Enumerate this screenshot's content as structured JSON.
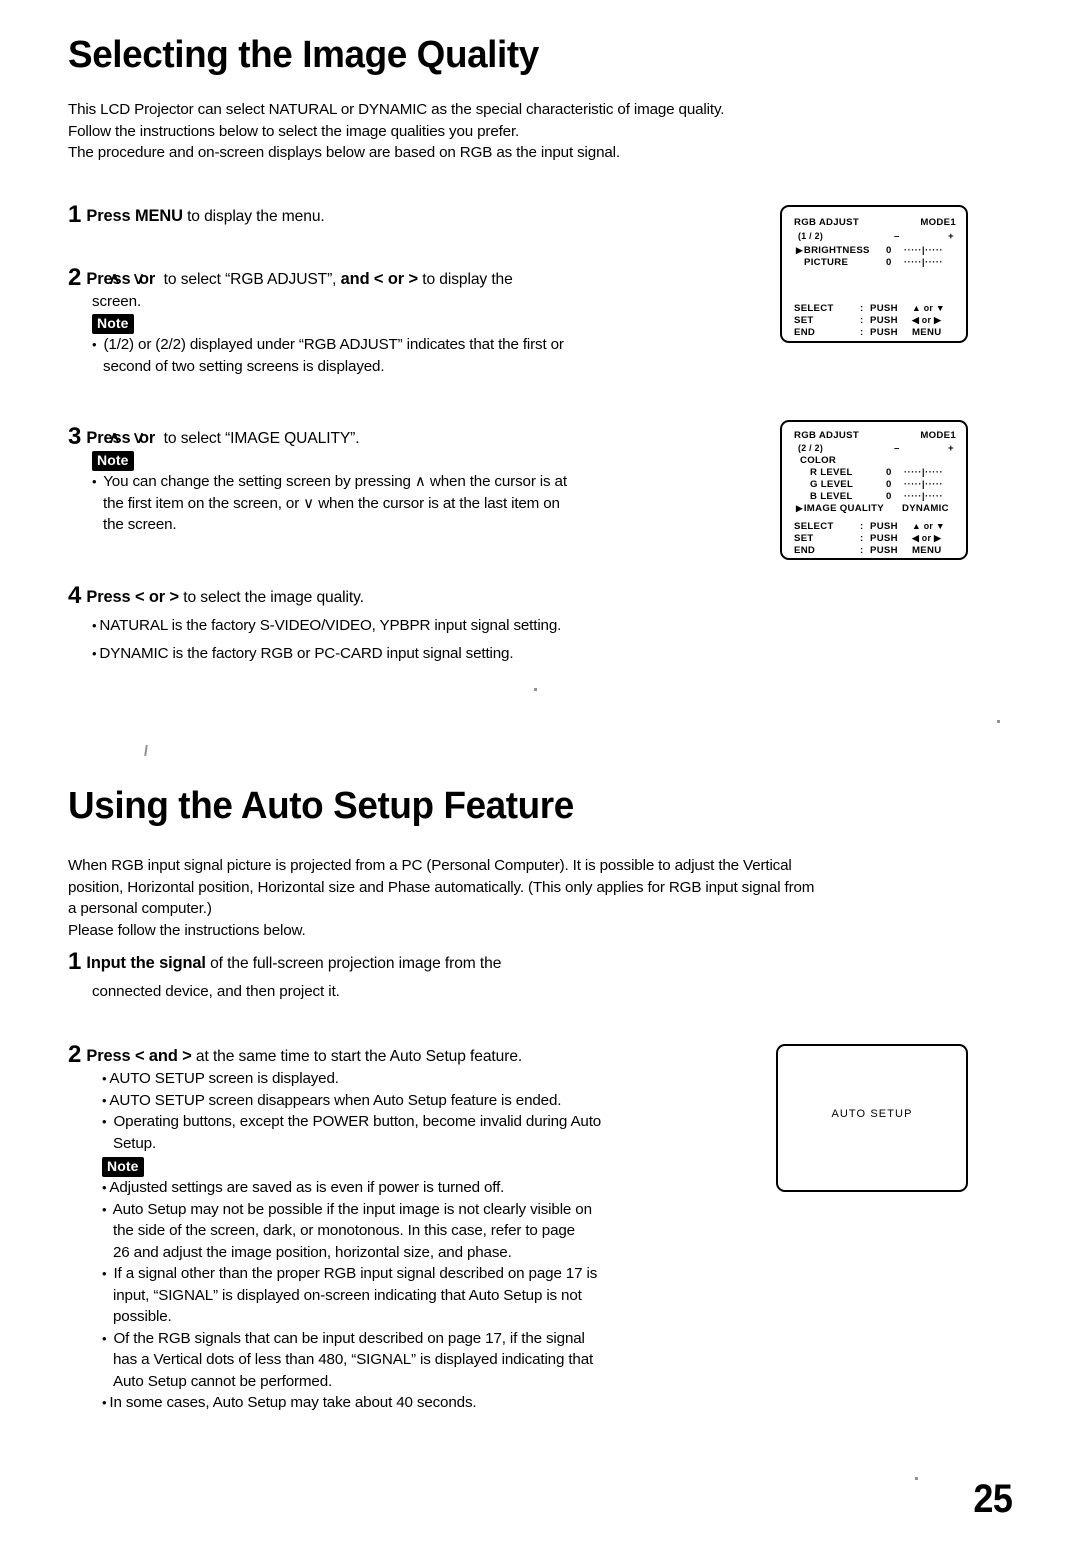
{
  "page": {
    "number": "25"
  },
  "sections": [
    {
      "title": "Selecting the Image Quality",
      "intro": [
        "This LCD Projector can select NATURAL or DYNAMIC as the special characteristic of image quality.",
        "Follow the instructions below to select the image qualities you prefer.",
        "The procedure and on-screen displays below are based on RGB as the input signal."
      ]
    },
    {
      "title": "Using the Auto Setup Feature",
      "intro": [
        "When RGB input signal picture is projected from a PC (Personal Computer). It is possible to adjust the Vertical",
        "position, Horizontal position, Horizontal size and Phase automatically. (This only applies for RGB input signal from",
        "a personal computer.)",
        "Please follow the instructions below."
      ]
    }
  ],
  "steps": {
    "s1": {
      "num": "1",
      "bold": "Press MENU",
      "rest": " to display the menu."
    },
    "s2": {
      "num": "2",
      "bold_a": "Press",
      "arrow_up": "∧",
      "or_a": "or",
      "arrow_down": "∨",
      "mid": " to select “RGB ADJUST”, ",
      "bold_b": "and < or >",
      "rest": " to display the",
      "cont": "screen.",
      "note_label": "Note",
      "notes": [
        {
          "lines": [
            "(1/2) or (2/2) displayed under “RGB ADJUST” indicates that the first or",
            "second of two setting screens is displayed."
          ]
        }
      ]
    },
    "s3": {
      "num": "3",
      "bold_a": "Press",
      "arrow_up": "∧",
      "or_a": "or",
      "arrow_down": "∨",
      "rest": " to select “IMAGE QUALITY”.",
      "note_label": "Note",
      "notes": [
        {
          "lines": [
            "You can change the setting screen by pressing ∧ when the cursor is at",
            "the first item on the screen, or ∨ when the cursor is at the last item on",
            "the screen."
          ]
        }
      ]
    },
    "s4": {
      "num": "4",
      "bold": "Press < or >",
      "rest": " to select the image quality.",
      "bullets": [
        "NATURAL is the factory S-VIDEO/VIDEO, YPBPR input signal setting.",
        "DYNAMIC is the factory RGB or PC-CARD input signal setting."
      ]
    },
    "a1": {
      "num": "1",
      "bold": "Input the signal",
      "rest": " of the full-screen projection image from the",
      "cont": "connected device, and then project it."
    },
    "a2": {
      "num": "2",
      "bold": "Press < and >",
      "rest": " at the same time to start the Auto Setup feature.",
      "bullets": [
        [
          "AUTO SETUP screen is displayed."
        ],
        [
          "AUTO SETUP screen disappears when Auto Setup feature is ended."
        ],
        [
          "Operating buttons, except the POWER button, become invalid during Auto",
          "Setup."
        ]
      ],
      "note_label": "Note",
      "notes": [
        [
          "Adjusted settings are saved as is even if power is turned off."
        ],
        [
          "Auto Setup may not be possible if the input image is not clearly visible on",
          "the side of the screen, dark, or monotonous. In this case, refer to page",
          "26 and adjust the image position, horizontal size, and phase."
        ],
        [
          "If a signal other than the proper RGB input signal described on page 17 is",
          "input, “SIGNAL” is displayed on-screen indicating that Auto Setup is not",
          "possible."
        ],
        [
          "Of the RGB signals that can be input described on page 17, if the signal",
          "has a Vertical dots of less than 480, “SIGNAL” is displayed indicating that",
          "Auto Setup cannot be performed."
        ],
        [
          "In some cases, Auto Setup may take about 40 seconds."
        ]
      ]
    }
  },
  "osd_screens": [
    {
      "name": "rgb-adjust-page-1",
      "title": "RGB ADJUST",
      "mode": "MODE1",
      "page_indicator": "(1 / 2)",
      "minus": "–",
      "plus": "+",
      "items": [
        {
          "cursor": "▶",
          "label": "BRIGHTNESS",
          "value": "0",
          "slider": "·····|·····"
        },
        {
          "cursor": "",
          "label": "PICTURE",
          "value": "0",
          "slider": "·····|·····"
        }
      ],
      "legend": [
        {
          "key": "SELECT",
          "sep": ":",
          "action": "PUSH",
          "keys": "▲ or ▼"
        },
        {
          "key": "SET",
          "sep": ":",
          "action": "PUSH",
          "keys": "◀ or ▶"
        },
        {
          "key": "END",
          "sep": ":",
          "action": "PUSH",
          "keys": "MENU"
        }
      ]
    },
    {
      "name": "rgb-adjust-page-2",
      "title": "RGB ADJUST",
      "mode": "MODE1",
      "page_indicator": "(2 / 2)",
      "minus": "–",
      "plus": "+",
      "group_label": "COLOR",
      "items": [
        {
          "cursor": "",
          "label": "R LEVEL",
          "value": "0",
          "slider": "·····|·····"
        },
        {
          "cursor": "",
          "label": "G LEVEL",
          "value": "0",
          "slider": "·····|·····"
        },
        {
          "cursor": "",
          "label": "B LEVEL",
          "value": "0",
          "slider": "·····|·····"
        }
      ],
      "selected_item": {
        "cursor": "▶",
        "label": "IMAGE QUALITY",
        "value": "DYNAMIC"
      },
      "legend": [
        {
          "key": "SELECT",
          "sep": ":",
          "action": "PUSH",
          "keys": "▲ or ▼"
        },
        {
          "key": "SET",
          "sep": ":",
          "action": "PUSH",
          "keys": "◀ or ▶"
        },
        {
          "key": "END",
          "sep": ":",
          "action": "PUSH",
          "keys": "MENU"
        }
      ]
    }
  ],
  "auto_setup_screen": {
    "label": "AUTO SETUP"
  }
}
